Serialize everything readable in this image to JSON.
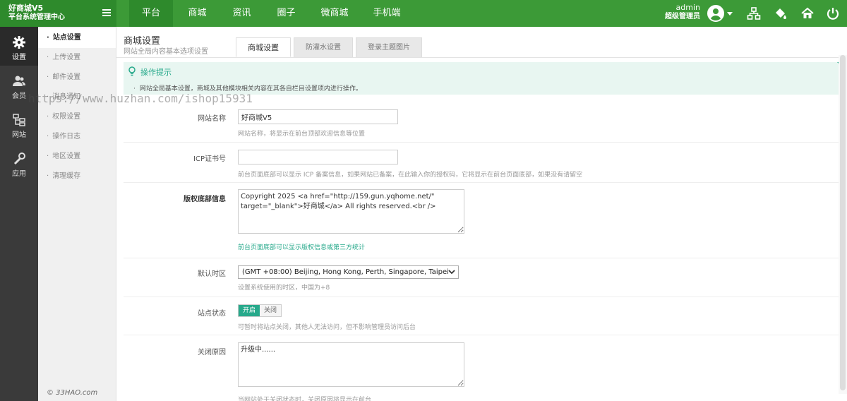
{
  "brand": {
    "line1": "好商城V5",
    "line2": "平台系统管理中心"
  },
  "nav": [
    "平台",
    "商城",
    "资讯",
    "圈子",
    "微商城",
    "手机端"
  ],
  "user": {
    "name": "admin",
    "role": "超级管理员"
  },
  "iconbar": [
    {
      "label": "设置",
      "icon": "gear-icon"
    },
    {
      "label": "会员",
      "icon": "users-icon"
    },
    {
      "label": "网站",
      "icon": "sitemap-icon"
    },
    {
      "label": "应用",
      "icon": "wrench-icon"
    }
  ],
  "submenu": [
    "站点设置",
    "上传设置",
    "邮件设置",
    "消息通知",
    "权限设置",
    "操作日志",
    "地区设置",
    "清理缓存"
  ],
  "footer_copyright": "© 33HAO.com",
  "watermark": "https://www.huzhan.com/ishop15931",
  "header": {
    "title": "商城设置",
    "subtitle": "网站全局内容基本选项设置"
  },
  "tabs": [
    "商城设置",
    "防灌水设置",
    "登录主题图片"
  ],
  "tips": {
    "title": "操作提示",
    "text": "网站全局基本设置，商城及其他模块相关内容在其各自栏目设置项内进行操作。"
  },
  "form": {
    "site_name": {
      "label": "网站名称",
      "value": "好商城V5",
      "hint": "网站名称，将显示在前台顶部欢迎信息等位置"
    },
    "icp": {
      "label": "ICP证书号",
      "value": "",
      "hint": "前台页面底部可以显示 ICP 备案信息，如果网站已备案，在此输入你的授权码，它将显示在前台页面底部，如果没有请留空"
    },
    "copyright": {
      "label": "版权底部信息",
      "value": "Copyright 2025 <a href=\"http://159.gun.yqhome.net/\" target=\"_blank\">好商城</a> All rights reserved.<br />",
      "hint": "前台页面底部可以显示版权信息或第三方统计"
    },
    "timezone": {
      "label": "默认时区",
      "value": "(GMT +08:00) Beijing, Hong Kong, Perth, Singapore, Taipei",
      "hint": "设置系统使用的时区，中国为+8"
    },
    "status": {
      "label": "站点状态",
      "on": "开启",
      "off": "关闭",
      "hint": "可暂时将站点关闭，其他人无法访问，但不影响管理员访问后台"
    },
    "close_reason": {
      "label": "关闭原因",
      "value": "升级中......",
      "hint": "当网站处于关闭状态时，关闭原因将显示在前台"
    }
  },
  "colors": {
    "topbar": "#3c9a37",
    "accent": "#27a98b",
    "tips_bg": "#e8f6f1"
  }
}
